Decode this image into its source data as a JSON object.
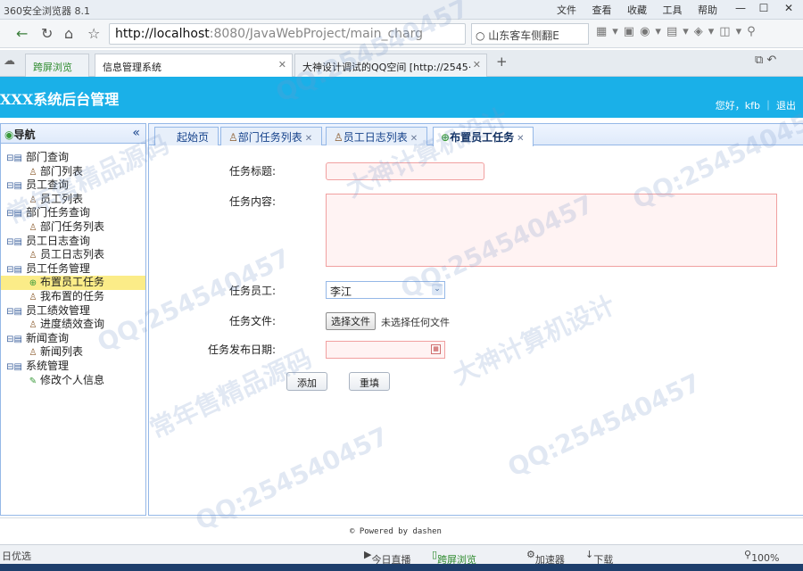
{
  "browser": {
    "title": "360安全浏览器 8.1",
    "menus": [
      "文件",
      "查看",
      "收藏",
      "工具",
      "帮助"
    ],
    "url_host": "http://localhost",
    "url_rest": ":8080/JavaWebProject/main_charg",
    "search_text": "山东客车侧翻E",
    "tabs": [
      {
        "label": "跨屏浏览"
      },
      {
        "label": "信息管理系统"
      },
      {
        "label": "大神设计调试的QQ空间 [http://2545·"
      }
    ],
    "status_left": "日优选",
    "status_items": [
      "今日直播",
      "跨屏浏览",
      "加速器",
      "下载"
    ],
    "zoom": "100%"
  },
  "app": {
    "title": "XXX系统后台管理",
    "user": "您好，kfb ｜ 退出"
  },
  "sidebar": {
    "title": "导航",
    "tree": [
      {
        "label": "部门查询",
        "type": "group"
      },
      {
        "label": "部门列表",
        "type": "leaf"
      },
      {
        "label": "员工查询",
        "type": "group"
      },
      {
        "label": "员工列表",
        "type": "leaf"
      },
      {
        "label": "部门任务查询",
        "type": "group"
      },
      {
        "label": "部门任务列表",
        "type": "leaf"
      },
      {
        "label": "员工日志查询",
        "type": "group"
      },
      {
        "label": "员工日志列表",
        "type": "leaf"
      },
      {
        "label": "员工任务管理",
        "type": "group"
      },
      {
        "label": "布置员工任务",
        "type": "leaf",
        "selected": true
      },
      {
        "label": "我布置的任务",
        "type": "leaf"
      },
      {
        "label": "员工绩效管理",
        "type": "group"
      },
      {
        "label": "进度绩效查询",
        "type": "leaf"
      },
      {
        "label": "新闻查询",
        "type": "group"
      },
      {
        "label": "新闻列表",
        "type": "leaf"
      },
      {
        "label": "系统管理",
        "type": "group"
      },
      {
        "label": "修改个人信息",
        "type": "leaf"
      }
    ]
  },
  "content_tabs": [
    {
      "label": "起始页",
      "closable": false
    },
    {
      "label": "部门任务列表",
      "closable": true
    },
    {
      "label": "员工日志列表",
      "closable": true
    },
    {
      "label": "布置员工任务",
      "closable": true,
      "active": true
    }
  ],
  "form": {
    "task_title_label": "任务标题:",
    "task_content_label": "任务内容:",
    "employee_label": "任务员工:",
    "employee_value": "李江",
    "file_label": "任务文件:",
    "file_button": "选择文件",
    "file_status": "未选择任何文件",
    "date_label": "任务发布日期:",
    "add_button": "添加",
    "reset_button": "重填"
  },
  "footer": "© Powered by dashen",
  "watermarks": [
    "QQ:254540457",
    "大神计算机设计",
    "常年售精品源码"
  ]
}
